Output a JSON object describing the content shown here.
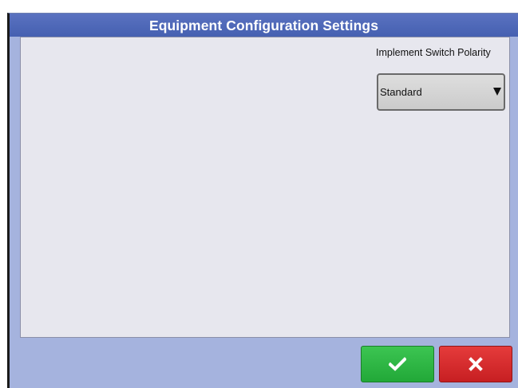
{
  "dialog": {
    "title": "Equipment Configuration Settings"
  },
  "implement_switch_polarity": {
    "label": "Implement Switch Polarity",
    "selected_value": "Standard",
    "dropdown_icon": "triangle-down-icon"
  },
  "buttons": {
    "ok": {
      "icon": "checkmark-icon",
      "color": "#2fb545"
    },
    "cancel": {
      "icon": "x-icon",
      "color": "#d62b2d"
    }
  },
  "colors": {
    "title_bar": "#4d67b8",
    "panel_background": "#a5b3de",
    "content_background": "#e7e7ee"
  }
}
